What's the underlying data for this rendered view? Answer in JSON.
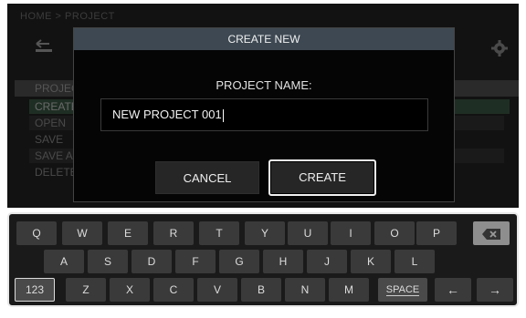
{
  "breadcrumb": "HOME > PROJECT",
  "icons": {
    "back": "back-arrow-icon",
    "settings": "gear-icon",
    "backspace": "backspace-icon"
  },
  "background": {
    "section_header": "PROJECT",
    "menu": [
      "CREATE",
      "OPEN",
      "SAVE",
      "SAVE AS",
      "DELETE"
    ]
  },
  "dialog": {
    "title": "CREATE NEW",
    "field_label": "PROJECT NAME:",
    "field_value": "NEW PROJECT 001",
    "cancel_label": "CANCEL",
    "create_label": "CREATE"
  },
  "keyboard": {
    "row1": [
      "Q",
      "W",
      "E",
      "R",
      "T",
      "Y",
      "U",
      "I",
      "O",
      "P"
    ],
    "row2": [
      "A",
      "S",
      "D",
      "F",
      "G",
      "H",
      "J",
      "K",
      "L"
    ],
    "row3": [
      "Z",
      "X",
      "C",
      "V",
      "B",
      "N",
      "M"
    ],
    "numeric_label": "123",
    "space_label": "SPACE",
    "left_label": "←",
    "right_label": "→"
  },
  "colors": {
    "title_bar": "#3d4852",
    "panel": "#050505",
    "key": "#3a3a3a"
  }
}
